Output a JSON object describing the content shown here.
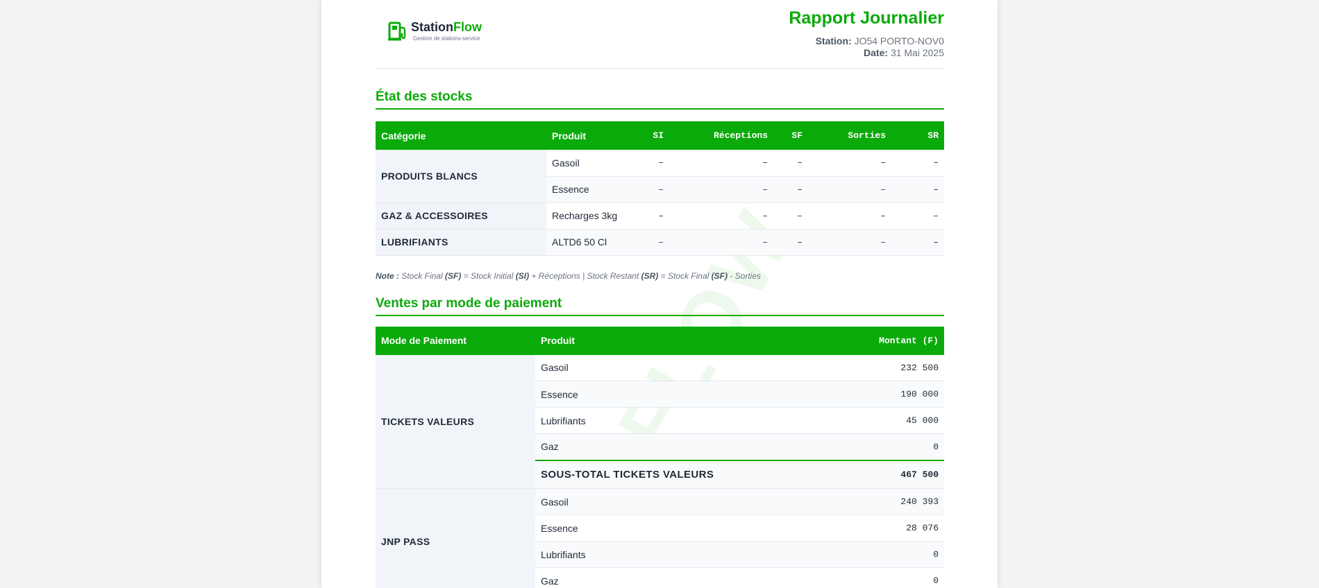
{
  "brand": {
    "name_part1": "Station",
    "name_part2": "Flow",
    "tagline": "Gestion de stations-service",
    "accent_color": "#0aaa0a",
    "icon": "fuel-pump-icon"
  },
  "report": {
    "title": "Rapport Journalier",
    "station_label": "Station:",
    "station_value": "JO54 PORTO-NOV0",
    "date_label": "Date:",
    "date_value": "31 Mai 2025"
  },
  "stocks": {
    "section_title": "État des stocks",
    "headers": [
      "Catégorie",
      "Produit",
      "SI",
      "Réceptions",
      "SF",
      "Sorties",
      "SR"
    ],
    "groups": [
      {
        "category": "PRODUITS BLANCS",
        "rows": [
          {
            "product": "Gasoil",
            "si": "–",
            "receptions": "–",
            "sf": "–",
            "sorties": "–",
            "sr": "–"
          },
          {
            "product": "Essence",
            "si": "–",
            "receptions": "–",
            "sf": "–",
            "sorties": "–",
            "sr": "–"
          }
        ]
      },
      {
        "category": "GAZ & ACCESSOIRES",
        "rows": [
          {
            "product": "Recharges 3kg",
            "si": "–",
            "receptions": "–",
            "sf": "–",
            "sorties": "–",
            "sr": "–"
          }
        ]
      },
      {
        "category": "LUBRIFIANTS",
        "rows": [
          {
            "product": "ALTD6 50 Cl",
            "si": "–",
            "receptions": "–",
            "sf": "–",
            "sorties": "–",
            "sr": "–"
          }
        ]
      }
    ],
    "note": {
      "label": "Note :",
      "p1": " Stock Final ",
      "sf": "(SF)",
      "p2": " = Stock Initial ",
      "si": "(SI)",
      "p3": " + Réceptions | Stock Restant ",
      "sr": "(SR)",
      "p4": " = Stock Final ",
      "sf2": "(SF)",
      "p5": " - Sorties"
    }
  },
  "ventes": {
    "section_title": "Ventes par mode de paiement",
    "headers": [
      "Mode de Paiement",
      "Produit",
      "Montant (F)"
    ],
    "groups": [
      {
        "mode": "TICKETS VALEURS",
        "rows": [
          {
            "product": "Gasoil",
            "amount": "232 500"
          },
          {
            "product": "Essence",
            "amount": "190 000"
          },
          {
            "product": "Lubrifiants",
            "amount": "45 000"
          },
          {
            "product": "Gaz",
            "amount": "0"
          }
        ],
        "subtotal_label": "SOUS-TOTAL TICKETS VALEURS",
        "subtotal_value": "467 500"
      },
      {
        "mode": "JNP PASS",
        "rows": [
          {
            "product": "Gasoil",
            "amount": "240 393"
          },
          {
            "product": "Essence",
            "amount": "28 076"
          },
          {
            "product": "Lubrifiants",
            "amount": "0"
          },
          {
            "product": "Gaz",
            "amount": "0"
          }
        ]
      }
    ]
  },
  "watermark": "IFLOW"
}
